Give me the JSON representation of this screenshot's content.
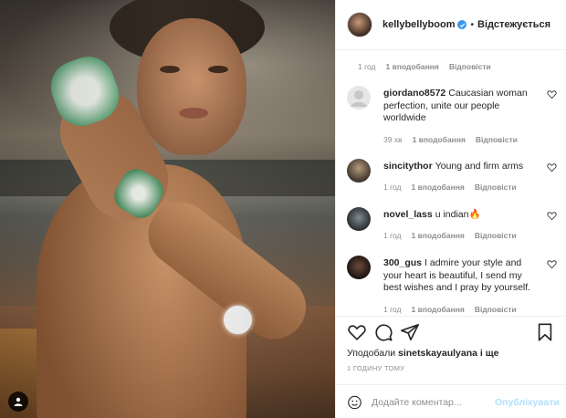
{
  "post": {
    "username": "kellybellyboom",
    "follow_label": "Відстежується",
    "separator": "•"
  },
  "colors": {
    "accent": "#3897f0",
    "post_button_disabled": "#b2dffc",
    "muted": "#8e8e8e"
  },
  "top_meta": {
    "time": "1 год",
    "likes": "1 вподобання",
    "reply": "Відповісти"
  },
  "comments": [
    {
      "user": "giordano8572",
      "text": "Caucasian woman perfection, unite our people worldwide",
      "time": "39 хв",
      "likes": "1 вподобання",
      "reply": "Відповісти",
      "avatar": "default-avatar"
    },
    {
      "user": "sincitythor",
      "text": "Young and firm arms",
      "time": "1 год",
      "likes": "1 вподобання",
      "reply": "Відповісти",
      "avatar": "photo-avatar"
    },
    {
      "user": "novel_lass",
      "text": "u indian🔥",
      "time": "1 год",
      "likes": "1 вподобання",
      "reply": "Відповісти",
      "avatar": "photo-avatar"
    },
    {
      "user": "300_gus",
      "text": "I admire your style and your heart is beautiful, I send my best wishes and I pray by yourself.",
      "time": "1 год",
      "likes": "1 вподобання",
      "reply": "Відповісти",
      "avatar": "photo-avatar"
    }
  ],
  "likes_line": {
    "prefix": "Уподобали",
    "user": "sinetskayaulyana",
    "suffix": "і ще"
  },
  "post_time": "1 ГОДИНУ ТОМУ",
  "add_comment": {
    "placeholder": "Додайте коментар...",
    "post_label": "Опублікувати"
  }
}
